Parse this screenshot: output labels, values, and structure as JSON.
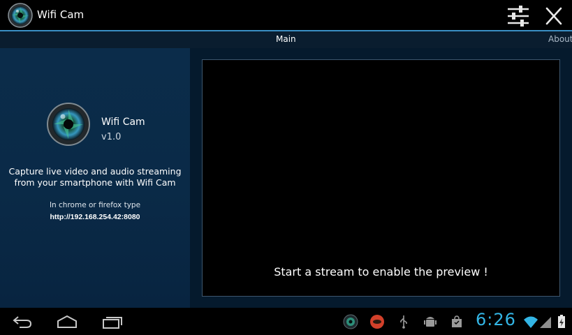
{
  "app": {
    "title": "Wifi Cam",
    "icon": "camera-lens-icon"
  },
  "toolbar": {
    "settings_icon": "sliders-icon",
    "close_icon": "close-icon"
  },
  "tabs": [
    {
      "label": "Main",
      "active": true
    },
    {
      "label": "About",
      "active": false
    }
  ],
  "info": {
    "name": "Wifi Cam",
    "version": "v1.0",
    "description_line1": "Capture live video and audio streaming",
    "description_line2": "from your smartphone with Wifi Cam",
    "hint": "In chrome or firefox type",
    "url": "http://192.168.254.42:8080"
  },
  "preview": {
    "message": "Start a stream to enable the preview !"
  },
  "system_bar": {
    "time": "6:26",
    "accent": "#33b5e5",
    "nav_icons": [
      "back-icon",
      "home-icon",
      "recent-apps-icon"
    ],
    "status_icons": [
      "wifi-cam-notification-icon",
      "notification-app-icon",
      "usb-icon",
      "android-debug-icon",
      "shopping-bag-icon",
      "wifi-icon",
      "signal-icon",
      "battery-icon"
    ]
  }
}
